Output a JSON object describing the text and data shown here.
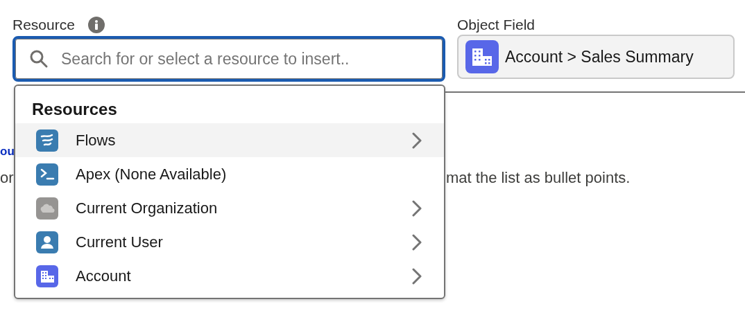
{
  "resource": {
    "label": "Resource",
    "search": {
      "placeholder": "Search for or select a resource to insert.."
    }
  },
  "object_field": {
    "label": "Object Field",
    "value": "Account > Sales Summary"
  },
  "background": {
    "link": "ou",
    "line_1": "or",
    "line_2": "mat the list as bullet points."
  },
  "dropdown": {
    "heading": "Resources",
    "items": [
      {
        "label": "Flows",
        "kind": "flows",
        "selected": true,
        "has_submenu": true
      },
      {
        "label": "Apex (None Available)",
        "kind": "apex",
        "selected": false,
        "has_submenu": false
      },
      {
        "label": "Current Organization",
        "kind": "org",
        "selected": false,
        "has_submenu": true
      },
      {
        "label": "Current User",
        "kind": "user",
        "selected": false,
        "has_submenu": true
      },
      {
        "label": "Account",
        "kind": "account",
        "selected": false,
        "has_submenu": true
      }
    ]
  }
}
